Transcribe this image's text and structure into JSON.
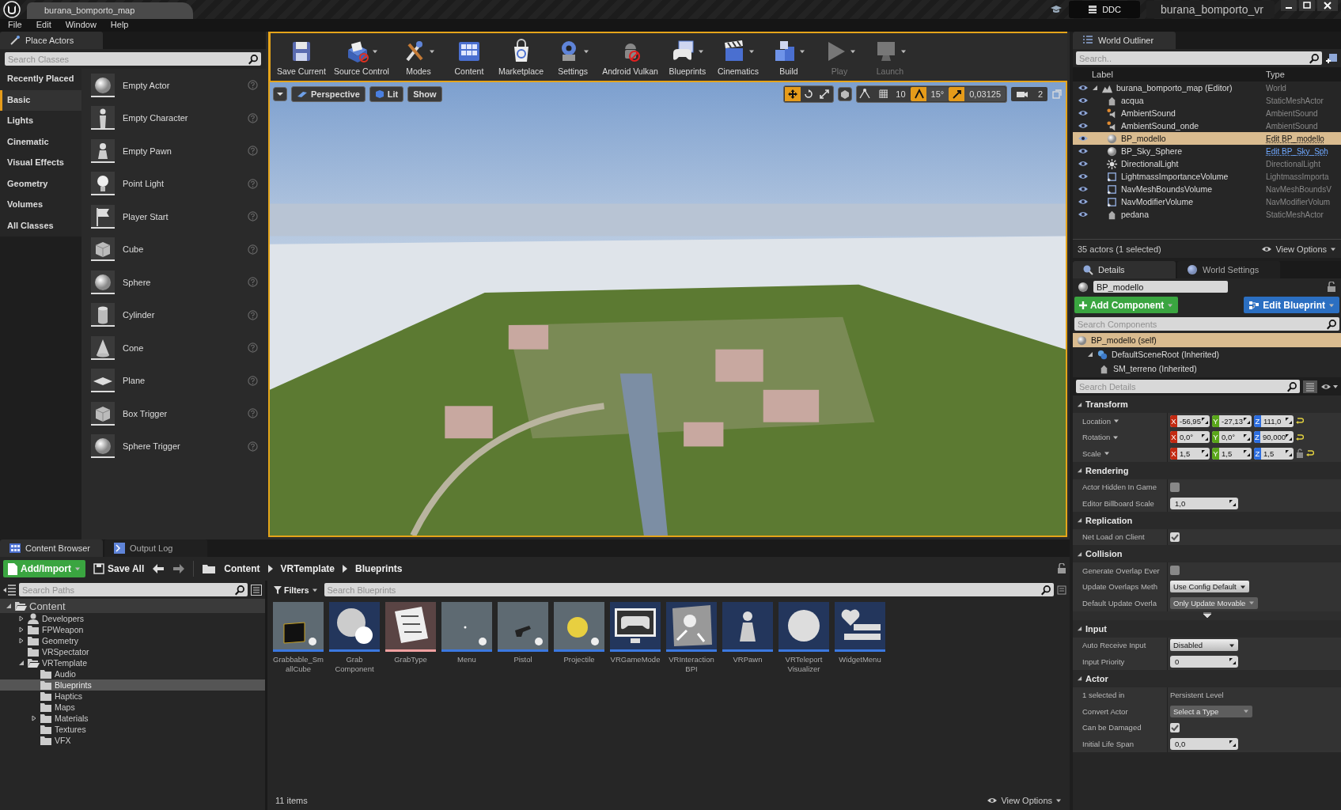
{
  "title_bar": {
    "map_tab": "burana_bomporto_map",
    "ddc_button": "DDC",
    "project_name": "burana_bomporto_vr"
  },
  "menu": [
    "File",
    "Edit",
    "Window",
    "Help"
  ],
  "place_actors": {
    "tab": "Place Actors",
    "search_placeholder": "Search Classes",
    "categories": [
      {
        "label": "Recently Placed",
        "selected": false
      },
      {
        "label": "Basic",
        "selected": true
      },
      {
        "label": "Lights",
        "selected": false
      },
      {
        "label": "Cinematic",
        "selected": false
      },
      {
        "label": "Visual Effects",
        "selected": false
      },
      {
        "label": "Geometry",
        "selected": false
      },
      {
        "label": "Volumes",
        "selected": false
      },
      {
        "label": "All Classes",
        "selected": false
      }
    ],
    "items": [
      {
        "label": "Empty Actor",
        "kind": "sphere"
      },
      {
        "label": "Empty Character",
        "kind": "figure"
      },
      {
        "label": "Empty Pawn",
        "kind": "pawn"
      },
      {
        "label": "Point Light",
        "kind": "bulb"
      },
      {
        "label": "Player Start",
        "kind": "flag"
      },
      {
        "label": "Cube",
        "kind": "cube"
      },
      {
        "label": "Sphere",
        "kind": "sphere"
      },
      {
        "label": "Cylinder",
        "kind": "cylinder"
      },
      {
        "label": "Cone",
        "kind": "cone"
      },
      {
        "label": "Plane",
        "kind": "plane"
      },
      {
        "label": "Box Trigger",
        "kind": "cube"
      },
      {
        "label": "Sphere Trigger",
        "kind": "sphere"
      }
    ]
  },
  "toolbar": [
    {
      "label": "Save Current",
      "kind": "save",
      "dropdown": false,
      "disabled": false
    },
    {
      "label": "Source Control",
      "kind": "source",
      "dropdown": true,
      "disabled": false
    },
    {
      "label": "Modes",
      "kind": "modes",
      "dropdown": true,
      "disabled": false
    },
    {
      "label": "Content",
      "kind": "content",
      "dropdown": false,
      "disabled": false
    },
    {
      "label": "Marketplace",
      "kind": "market",
      "dropdown": false,
      "disabled": false
    },
    {
      "label": "Settings",
      "kind": "settings",
      "dropdown": true,
      "disabled": false
    },
    {
      "label": "Android Vulkan",
      "kind": "android",
      "dropdown": false,
      "disabled": false
    },
    {
      "label": "Blueprints",
      "kind": "blueprints",
      "dropdown": true,
      "disabled": false
    },
    {
      "label": "Cinematics",
      "kind": "cinematics",
      "dropdown": true,
      "disabled": false
    },
    {
      "label": "Build",
      "kind": "build",
      "dropdown": true,
      "disabled": false
    },
    {
      "label": "Play",
      "kind": "play",
      "dropdown": true,
      "disabled": true
    },
    {
      "label": "Launch",
      "kind": "launch",
      "dropdown": true,
      "disabled": true
    }
  ],
  "viewport": {
    "buttons": [
      {
        "label": "Perspective",
        "kind": "perspective"
      },
      {
        "label": "Lit",
        "kind": "lit"
      },
      {
        "label": "Show",
        "kind": "plain"
      }
    ],
    "transform_tools": [
      {
        "kind": "move",
        "selected": true
      },
      {
        "kind": "rotate",
        "selected": false
      },
      {
        "kind": "scale",
        "selected": false
      }
    ],
    "snaps": [
      {
        "kind": "grid",
        "value": "10",
        "on": false
      },
      {
        "kind": "angle",
        "value": "15°",
        "on": true
      },
      {
        "kind": "scale",
        "value": "0,03125",
        "on": true
      }
    ],
    "camera_speed": "2"
  },
  "world_outliner": {
    "tab": "World Outliner",
    "search_placeholder": "Search..",
    "columns": [
      "Label",
      "Type"
    ],
    "rows": [
      {
        "label": "burana_bomporto_map (Editor)",
        "type": "World",
        "kind": "world",
        "type_link": false,
        "selected": false,
        "expanded": true,
        "children": [
          {
            "label": "acqua",
            "type": "StaticMeshActor",
            "kind": "mesh",
            "type_link": false,
            "selected": false
          },
          {
            "label": "AmbientSound",
            "type": "AmbientSound",
            "kind": "sound",
            "type_link": false,
            "selected": false
          },
          {
            "label": "AmbientSound_onde",
            "type": "AmbientSound",
            "kind": "sound",
            "type_link": false,
            "selected": false
          },
          {
            "label": "BP_modello",
            "type": "Edit BP_modello",
            "kind": "sphere",
            "type_link": true,
            "selected": true
          },
          {
            "label": "BP_Sky_Sphere",
            "type": "Edit BP_Sky_Sph",
            "kind": "sphere",
            "type_link": true,
            "selected": false
          },
          {
            "label": "DirectionalLight",
            "type": "DirectionalLight",
            "kind": "light",
            "type_link": false,
            "selected": false
          },
          {
            "label": "LightmassImportanceVolume",
            "type": "LightmassImporta",
            "kind": "volume",
            "type_link": false,
            "selected": false
          },
          {
            "label": "NavMeshBoundsVolume",
            "type": "NavMeshBoundsV",
            "kind": "volume",
            "type_link": false,
            "selected": false
          },
          {
            "label": "NavModifierVolume",
            "type": "NavModifierVolum",
            "kind": "volume",
            "type_link": false,
            "selected": false
          },
          {
            "label": "pedana",
            "type": "StaticMeshActor",
            "kind": "mesh",
            "type_link": false,
            "selected": false
          }
        ]
      }
    ],
    "summary": "35 actors (1 selected)",
    "view_options": "View Options"
  },
  "details": {
    "tabs": [
      {
        "label": "Details",
        "kind": "details",
        "selected": true
      },
      {
        "label": "World Settings",
        "kind": "world",
        "selected": false
      }
    ],
    "actor_name": "BP_modello",
    "add_component": "Add Component",
    "edit_blueprint": "Edit Blueprint",
    "search_components_placeholder": "Search Components",
    "components": [
      {
        "label": "BP_modello (self)",
        "kind": "self",
        "selected": true
      },
      {
        "label": "DefaultSceneRoot (Inherited)",
        "kind": "root",
        "selected": false,
        "expanded": true,
        "children": [
          {
            "label": "SM_terreno (Inherited)",
            "kind": "mesh",
            "selected": false
          }
        ]
      }
    ],
    "search_details_placeholder": "Search Details",
    "sections": [
      {
        "title": "Transform",
        "expanded": true,
        "more": false,
        "rows": [
          {
            "label": "Location",
            "kind": "vector",
            "dropdown": true,
            "fields": [
              {
                "axis": "X",
                "value": "-56,95"
              },
              {
                "axis": "Y",
                "value": "-27,13"
              },
              {
                "axis": "Z",
                "value": "111,0"
              }
            ]
          },
          {
            "label": "Rotation",
            "kind": "vector",
            "dropdown": true,
            "fields": [
              {
                "axis": "X",
                "value": "0,0°"
              },
              {
                "axis": "Y",
                "value": "0,0°"
              },
              {
                "axis": "Z",
                "value": "90,000"
              }
            ]
          },
          {
            "label": "Scale",
            "kind": "vector",
            "dropdown": true,
            "lock": true,
            "fields": [
              {
                "axis": "X",
                "value": "1,5"
              },
              {
                "axis": "Y",
                "value": "1,5"
              },
              {
                "axis": "Z",
                "value": "1,5"
              }
            ]
          }
        ]
      },
      {
        "title": "Rendering",
        "expanded": true,
        "more": false,
        "rows": [
          {
            "label": "Actor Hidden In Game",
            "kind": "checkbox",
            "checked": false
          },
          {
            "label": "Editor Billboard Scale",
            "kind": "number",
            "value": "1,0"
          }
        ]
      },
      {
        "title": "Replication",
        "expanded": true,
        "more": false,
        "rows": [
          {
            "label": "Net Load on Client",
            "kind": "checkbox",
            "checked": true
          }
        ]
      },
      {
        "title": "Collision",
        "expanded": true,
        "more": true,
        "rows": [
          {
            "label": "Generate Overlap Ever",
            "kind": "checkbox",
            "checked": false
          },
          {
            "label": "Update Overlaps Meth",
            "kind": "dropdown",
            "value": "Use Config Default",
            "disabled": false
          },
          {
            "label": "Default Update Overla",
            "kind": "dropdown",
            "value": "Only Update Movable",
            "disabled": true
          }
        ]
      },
      {
        "title": "Input",
        "expanded": true,
        "more": false,
        "rows": [
          {
            "label": "Auto Receive Input",
            "kind": "dropdown",
            "value": "Disabled",
            "disabled": false
          },
          {
            "label": "Input Priority",
            "kind": "number",
            "value": "0"
          }
        ]
      },
      {
        "title": "Actor",
        "expanded": true,
        "more": false,
        "rows": [
          {
            "label": "1 selected in",
            "kind": "text",
            "value": "Persistent Level"
          },
          {
            "label": "Convert Actor",
            "kind": "dropdown",
            "value": "Select a Type",
            "disabled": true
          },
          {
            "label": "Can be Damaged",
            "kind": "checkbox",
            "checked": true
          },
          {
            "label": "Initial Life Span",
            "kind": "number",
            "value": "0,0"
          }
        ]
      }
    ]
  },
  "content_browser": {
    "tabs": [
      {
        "label": "Content Browser",
        "kind": "content",
        "selected": true
      },
      {
        "label": "Output Log",
        "kind": "log",
        "selected": false
      }
    ],
    "add_import": "Add/Import",
    "save_all": "Save All",
    "breadcrumb": [
      "Content",
      "VRTemplate",
      "Blueprints"
    ],
    "search_paths_placeholder": "Search Paths",
    "tree": [
      {
        "label": "Content",
        "kind": "root",
        "selected": false,
        "expanded": true,
        "children": [
          {
            "label": "Developers",
            "kind": "developer",
            "selected": false,
            "expanded": false
          },
          {
            "label": "FPWeapon",
            "kind": "folder",
            "selected": false,
            "expanded": false
          },
          {
            "label": "Geometry",
            "kind": "folder",
            "selected": false,
            "expanded": false
          },
          {
            "label": "VRSpectator",
            "kind": "folder",
            "selected": false
          },
          {
            "label": "VRTemplate",
            "kind": "folder",
            "selected": false,
            "expanded": true,
            "children": [
              {
                "label": "Audio",
                "kind": "folder",
                "selected": false
              },
              {
                "label": "Blueprints",
                "kind": "folder",
                "selected": true
              },
              {
                "label": "Haptics",
                "kind": "folder",
                "selected": false
              },
              {
                "label": "Maps",
                "kind": "folder",
                "selected": false
              },
              {
                "label": "Materials",
                "kind": "folder",
                "selected": false,
                "expanded": false
              },
              {
                "label": "Textures",
                "kind": "folder",
                "selected": false
              },
              {
                "label": "VFX",
                "kind": "folder",
                "selected": false
              }
            ]
          }
        ]
      }
    ],
    "filters": "Filters",
    "search_placeholder": "Search Blueprints",
    "assets": [
      {
        "label": "Grabbable_SmallCube",
        "kind": "cube",
        "color": "#3b78e0"
      },
      {
        "label": "Grab Component",
        "kind": "spheres",
        "color": "#3b78e0"
      },
      {
        "label": "GrabType",
        "kind": "document",
        "color": "#f0a0a0"
      },
      {
        "label": "Menu",
        "kind": "scene",
        "color": "#3b78e0"
      },
      {
        "label": "Pistol",
        "kind": "pistol",
        "color": "#3b78e0"
      },
      {
        "label": "Projectile",
        "kind": "ball",
        "color": "#3b78e0"
      },
      {
        "label": "VRGameMode",
        "kind": "gamepad",
        "color": "#3b78e0"
      },
      {
        "label": "VRInteraction BPI",
        "kind": "map",
        "color": "#3b78e0"
      },
      {
        "label": "VRPawn",
        "kind": "pawn",
        "color": "#3b78e0"
      },
      {
        "label": "VRTeleport Visualizer",
        "kind": "sphere",
        "color": "#3b78e0"
      },
      {
        "label": "WidgetMenu",
        "kind": "widget",
        "color": "#3b78e0"
      }
    ],
    "item_count": "11 items",
    "view_options": "View Options"
  }
}
